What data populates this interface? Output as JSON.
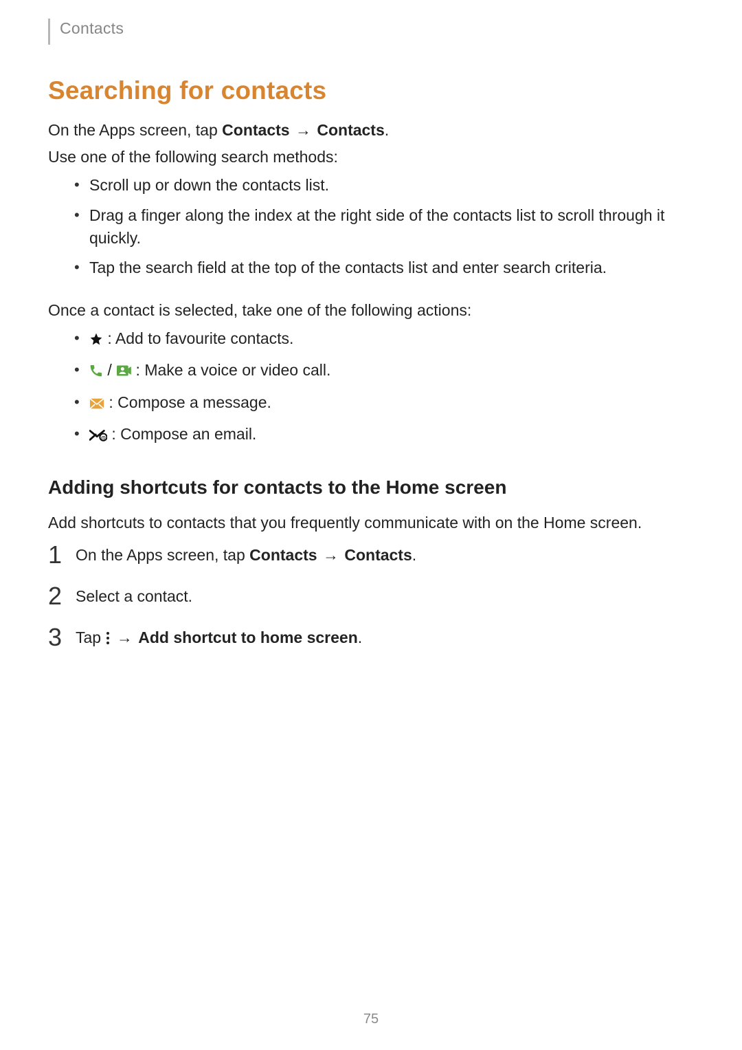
{
  "header": {
    "section_label": "Contacts"
  },
  "title": "Searching for contacts",
  "intro": {
    "line1_pre": "On the Apps screen, tap ",
    "line1_bold1": "Contacts",
    "line1_arrow": " → ",
    "line1_bold2": "Contacts",
    "line1_post": ".",
    "line2": "Use one of the following search methods:"
  },
  "search_methods": [
    "Scroll up or down the contacts list.",
    "Drag a finger along the index at the right side of the contacts list to scroll through it quickly.",
    "Tap the search field at the top of the contacts list and enter search criteria."
  ],
  "actions_intro": "Once a contact is selected, take one of the following actions:",
  "actions": [
    {
      "icon_name": "star-icon",
      "text_after": " : Add to favourite contacts."
    },
    {
      "icon_name": "call-icons",
      "text_after": " : Make a voice or video call."
    },
    {
      "icon_name": "message-icon",
      "text_after": " : Compose a message."
    },
    {
      "icon_name": "email-icon",
      "text_after": " : Compose an email."
    }
  ],
  "subheading": "Adding shortcuts for contacts to the Home screen",
  "subheading_para": "Add shortcuts to contacts that you frequently communicate with on the Home screen.",
  "steps": {
    "s1_pre": "On the Apps screen, tap ",
    "s1_bold1": "Contacts",
    "s1_arrow": " → ",
    "s1_bold2": "Contacts",
    "s1_post": ".",
    "s2": "Select a contact.",
    "s3_pre": "Tap ",
    "s3_arrow": " → ",
    "s3_bold": "Add shortcut to home screen",
    "s3_post": "."
  },
  "page_number": "75"
}
